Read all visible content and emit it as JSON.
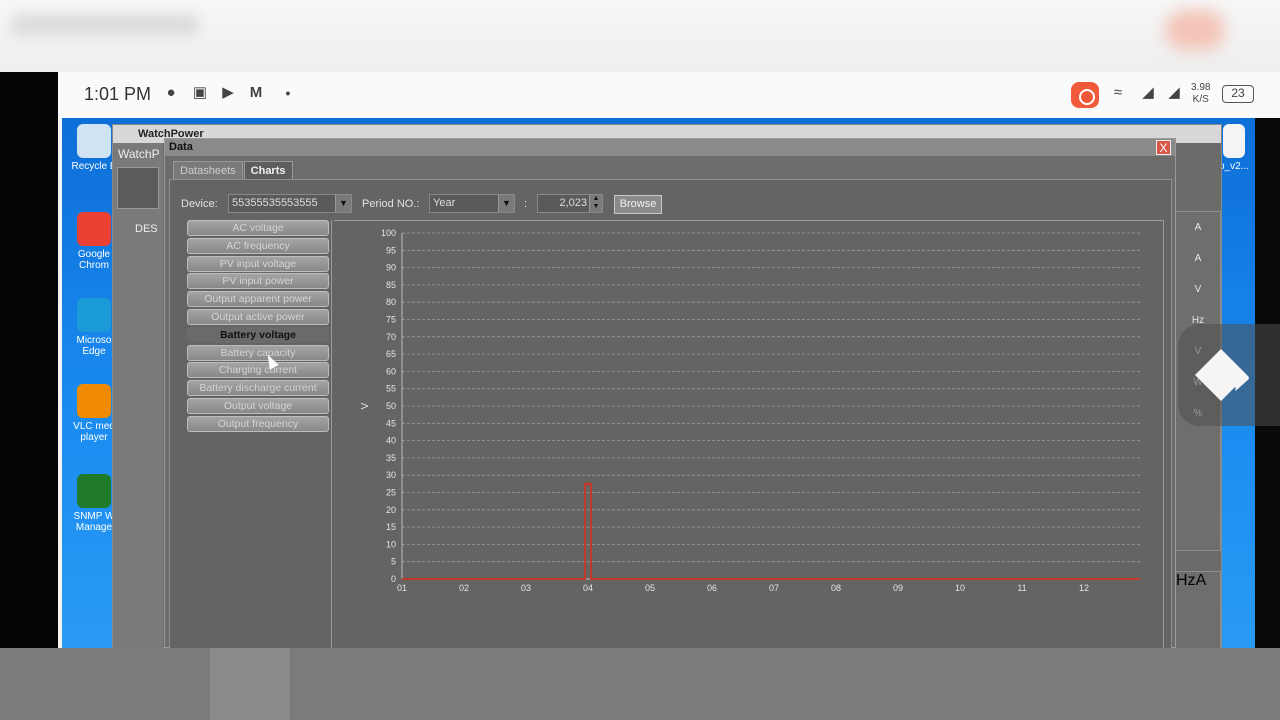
{
  "phone_status": {
    "time": "1:01 PM",
    "net_speed_value": "3.98",
    "net_speed_unit": "K/S",
    "battery": "23"
  },
  "desktop_icons": [
    {
      "label": "Recycle B",
      "color": "#cfe3f2"
    },
    {
      "label": "Google Chrom",
      "color": "#e94235"
    },
    {
      "label": "Microso Edge",
      "color": "#1a9bd8"
    },
    {
      "label": "VLC med player",
      "color": "#f08a00"
    },
    {
      "label": "SNMP W Manage",
      "color": "#1f7a2a"
    }
  ],
  "app_window": {
    "title": "WatchPower",
    "partial_label": "WatchP",
    "tree_label": "DES",
    "right_units": [
      "A",
      "A",
      "V",
      "Hz",
      "V",
      "W",
      "%"
    ],
    "right_units_lower": [
      "Hz",
      "A"
    ],
    "desktop_file_label": "o_v2..."
  },
  "data_window": {
    "title": "Data",
    "close": "X",
    "tabs": [
      {
        "label": "Datasheets",
        "active": false
      },
      {
        "label": "Charts",
        "active": true
      }
    ],
    "toolbar": {
      "device_label": "Device:",
      "device_value": "55355535553555",
      "period_label": "Period NO.:",
      "period_value": "Year",
      "separator": ":",
      "year_value": "2,023",
      "browse_label": "Browse"
    },
    "series_buttons": [
      {
        "label": "AC voltage",
        "active": false
      },
      {
        "label": "AC frequency",
        "active": false
      },
      {
        "label": "PV input voltage",
        "active": false
      },
      {
        "label": "PV input power",
        "active": false
      },
      {
        "label": "Output apparent power",
        "active": false
      },
      {
        "label": "Output active power",
        "active": false
      },
      {
        "label": "Battery voltage",
        "active": true
      },
      {
        "label": "Battery capacity",
        "active": false
      },
      {
        "label": "Charging current",
        "active": false
      },
      {
        "label": "Battery discharge current",
        "active": false
      },
      {
        "label": "Output voltage",
        "active": false
      },
      {
        "label": "Output frequency",
        "active": false
      }
    ]
  },
  "chart_data": {
    "type": "line",
    "ylabel": "V",
    "xlabel": "",
    "title": "",
    "ylim": [
      0,
      100
    ],
    "yticks": [
      0,
      5,
      10,
      15,
      20,
      25,
      30,
      35,
      40,
      45,
      50,
      55,
      60,
      65,
      70,
      75,
      80,
      85,
      90,
      95,
      100
    ],
    "x": [
      "01",
      "02",
      "03",
      "04",
      "05",
      "06",
      "07",
      "08",
      "09",
      "10",
      "11",
      "12"
    ],
    "grid": true,
    "series": [
      {
        "color": "#c0392b",
        "values": [
          0,
          0,
          0,
          27.5,
          0,
          0,
          0,
          0,
          0,
          0,
          0,
          0
        ]
      }
    ]
  }
}
